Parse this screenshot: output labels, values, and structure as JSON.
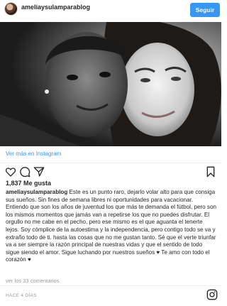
{
  "header": {
    "username": "ameliaysulamparablog",
    "follow_label": "Seguir"
  },
  "link": {
    "view_more_label": "Ver más en Instagram"
  },
  "actions": {
    "icons": [
      "heart-icon",
      "comment-icon",
      "share-icon",
      "bookmark-icon"
    ]
  },
  "post": {
    "likes": "1,837 Me gusta",
    "caption_user": "ameliaysulamparablog",
    "caption_text": "Este es un punto raro, dejarlo volar alto para que consiga sus sueños. Sin fines de semana libres ni oportunidades para vacacionar. Entiendo que son los años de juventud los que más te demanda el fútbol, pero son los mismos momentos que jamás van a repetirse los que no puedes disfrutar. El orgullo no me cabe en el pecho, pero ese mismo es el que aguanta el tenerte lejos. Soy cómplice de la autoestima y la independencia, pero contigo todo se va y extraño todo de ti. hasta las cosas que no me gustan tanto. Sé que el verte triunfar va a ser siempre la razón principal de nuestras vidas y que el sentido de todo sigue siendo el amor. Sigue luchando por nuestros sueños ♥ Te amo con todo el corazón ♥",
    "comments_label": "ver los 33 comentarios",
    "timestamp": "HACE 4 DÍAS"
  },
  "colors": {
    "accent": "#3897f0",
    "text": "#262626",
    "muted": "#999999"
  }
}
